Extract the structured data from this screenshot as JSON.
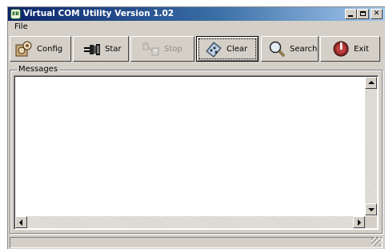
{
  "window": {
    "title": "Virtual COM Utility Version 1.02",
    "icon_name": "app-icon",
    "icon_text": "EB",
    "controls": {
      "minimize": "minimize-icon",
      "maximize": "maximize-icon",
      "close_glyph": "✕"
    }
  },
  "menu": {
    "items": [
      {
        "label": "File"
      }
    ]
  },
  "toolbar": {
    "buttons": [
      {
        "id": "config",
        "label": "Config",
        "icon": "config-icon",
        "enabled": true
      },
      {
        "id": "start",
        "label": "Star",
        "icon": "plug-icon",
        "enabled": true
      },
      {
        "id": "stop",
        "label": "Stop",
        "icon": "unplug-icon",
        "enabled": false
      },
      {
        "id": "clear",
        "label": "Clear",
        "icon": "clear-icon",
        "enabled": true,
        "focused": true
      },
      {
        "id": "search",
        "label": "Search",
        "icon": "magnifier-icon",
        "enabled": true
      },
      {
        "id": "exit",
        "label": "Exit",
        "icon": "exit-icon",
        "enabled": true
      }
    ]
  },
  "messages": {
    "group_label": "Messages",
    "content": ""
  },
  "colors": {
    "title_start": "#0a246a",
    "title_end": "#a6caf0",
    "face": "#d4d0c8",
    "disabled_text": "#8e8c86"
  }
}
